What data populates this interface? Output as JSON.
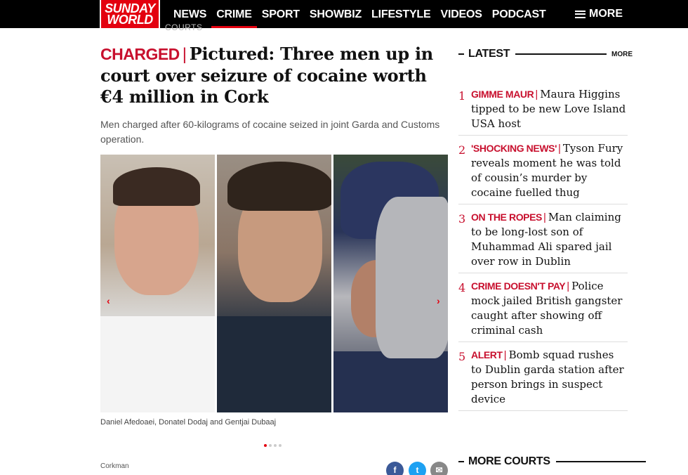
{
  "brand": {
    "line1": "SUNDAY",
    "line2": "WORLD",
    "color": "#e3000f"
  },
  "nav": {
    "items": [
      "NEWS",
      "CRIME",
      "SPORT",
      "SHOWBIZ",
      "LIFESTYLE",
      "VIDEOS",
      "PODCAST"
    ],
    "active": "CRIME",
    "more_label": "MORE"
  },
  "breadcrumb": "COURTS",
  "article": {
    "kicker": "CHARGED",
    "separator": "|",
    "title": "Pictured: Three men up in court over seizure of cocaine worth €4 million in Cork",
    "standfirst": "Men charged after 60-kilograms of cocaine seized in joint Garda and Customs operation.",
    "caption": "Daniel Afedoaei, Donatel Dodaj and Gentjai Dubaaj",
    "author": "Corkman",
    "gallery_prev": "‹",
    "gallery_next": "›",
    "gallery_active_index": 1,
    "gallery_count": 4
  },
  "sidebar": {
    "latest_title": "LATEST",
    "more_label": "MORE",
    "more_courts_title": "MORE COURTS",
    "stories": [
      {
        "num": "1",
        "kicker": "GIMME MAUR",
        "title": "Maura Higgins tipped to be new Love Island USA host"
      },
      {
        "num": "2",
        "kicker": "'SHOCKING NEWS'",
        "title": "Tyson Fury reveals moment he was told of cousin’s murder by cocaine fuelled thug"
      },
      {
        "num": "3",
        "kicker": "ON THE ROPES",
        "title": "Man claiming to be long-lost son of Muhammad Ali spared jail over row in Dublin"
      },
      {
        "num": "4",
        "kicker": "CRIME DOESN'T PAY",
        "title": "Police mock jailed British gangster caught after showing off criminal cash"
      },
      {
        "num": "5",
        "kicker": "ALERT",
        "title": "Bomb squad rushes to Dublin garda station after person brings in suspect device"
      }
    ]
  },
  "share": {
    "facebook": "f",
    "twitter": "t",
    "email": "✉"
  }
}
